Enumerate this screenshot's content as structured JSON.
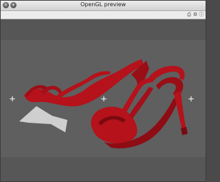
{
  "window": {
    "title": "OpenGL preview",
    "close_icon": "×",
    "zoom_icon": "+"
  },
  "toolbar": {
    "icons": [
      "export-icon",
      "settings-icon",
      "info-icon"
    ],
    "glyphs": [
      "⎙",
      "⚙",
      "ⓘ"
    ]
  },
  "viewport": {
    "crosshair": "+"
  },
  "colors": {
    "shoe_red": "#b5121b",
    "shoe_dark": "#7a0a10",
    "shadow": "#c8c8c8",
    "background": "#5c5c5c"
  }
}
